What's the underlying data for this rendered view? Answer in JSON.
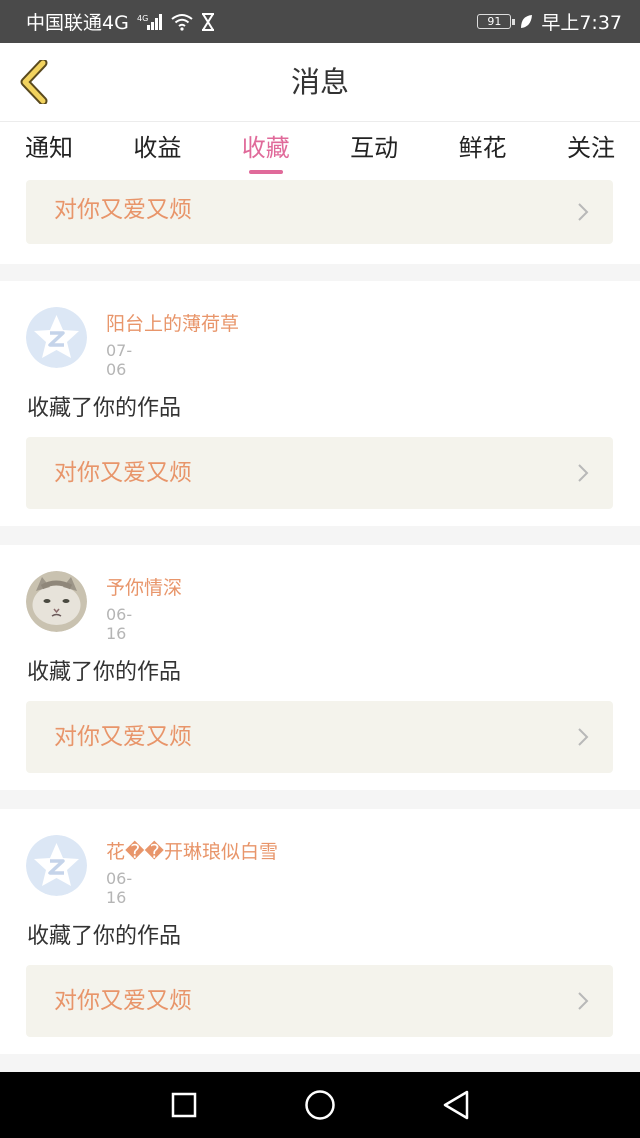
{
  "status_bar": {
    "carrier": "中国联通4G",
    "network": "4G",
    "battery": "91",
    "time": "早上7:37"
  },
  "header": {
    "title": "消息",
    "back_icon": "chevron-left-icon"
  },
  "tabs": [
    {
      "label": "通知",
      "active": false
    },
    {
      "label": "收益",
      "active": false
    },
    {
      "label": "收藏",
      "active": true
    },
    {
      "label": "互动",
      "active": false
    },
    {
      "label": "鲜花",
      "active": false
    },
    {
      "label": "关注",
      "active": false
    }
  ],
  "colors": {
    "accent": "#e06a9a",
    "username": "#e8956a",
    "link_bg": "#f4f3ec"
  },
  "feed": {
    "partial_item": {
      "work_title": "对你又爱又烦"
    },
    "items": [
      {
        "username": "阳台上的薄荷草",
        "date": "07-06",
        "action": "收藏了你的作品",
        "work_title": "对你又爱又烦",
        "avatar": "default-avatar"
      },
      {
        "username": "予你情深",
        "date": "06-16",
        "action": "收藏了你的作品",
        "work_title": "对你又爱又烦",
        "avatar": "cat-avatar"
      },
      {
        "username": "花��开琳琅似白雪",
        "date": "06-16",
        "action": "收藏了你的作品",
        "work_title": "对你又爱又烦",
        "avatar": "default-avatar"
      }
    ]
  },
  "nav_bar": {
    "buttons": [
      "recent-apps-icon",
      "home-icon",
      "back-icon"
    ]
  }
}
